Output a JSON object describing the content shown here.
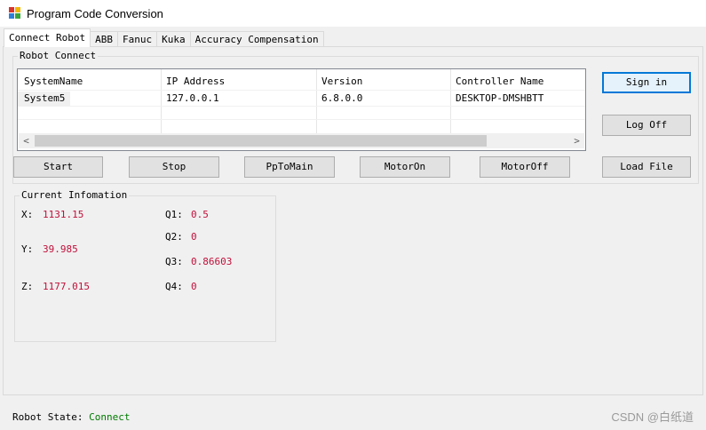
{
  "window": {
    "title": "Program Code Conversion"
  },
  "tabs": [
    {
      "label": "Connect Robot",
      "active": true
    },
    {
      "label": "ABB"
    },
    {
      "label": "Fanuc"
    },
    {
      "label": "Kuka"
    },
    {
      "label": "Accuracy Compensation"
    }
  ],
  "robot_connect": {
    "title": "Robot Connect",
    "columns": [
      "SystemName",
      "IP Address",
      "Version",
      "Controller Name"
    ],
    "rows": [
      [
        "System5",
        "127.0.0.1",
        "6.8.0.0",
        "DESKTOP-DMSHBTT"
      ]
    ],
    "scroll_left": "<",
    "scroll_right": ">"
  },
  "buttons": {
    "sign_in": "Sign in",
    "log_off": "Log Off",
    "start": "Start",
    "stop": "Stop",
    "pp_to_main": "PpToMain",
    "motor_on": "MotorOn",
    "motor_off": "MotorOff",
    "load_file": "Load File"
  },
  "current_info": {
    "title": "Current Infomation",
    "x_label": "X:",
    "x_value": "1131.15",
    "y_label": "Y:",
    "y_value": "39.985",
    "z_label": "Z:",
    "z_value": "1177.015",
    "q1_label": "Q1:",
    "q1_value": "0.5",
    "q2_label": "Q2:",
    "q2_value": "0",
    "q3_label": "Q3:",
    "q3_value": "0.86603",
    "q4_label": "Q4:",
    "q4_value": "0"
  },
  "status": {
    "label": "Robot State:",
    "value": "Connect"
  },
  "watermark": "CSDN @白纸道",
  "colors": {
    "value_text": "#c0103a",
    "status_ok": "#007a00",
    "default_button_border": "#0078d7"
  }
}
